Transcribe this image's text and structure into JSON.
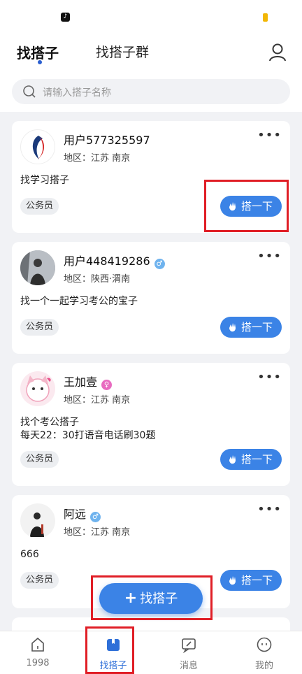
{
  "header": {
    "tabs": [
      {
        "label": "找搭子",
        "active": true
      },
      {
        "label": "找搭子群",
        "active": false
      }
    ],
    "user_icon": "user-icon"
  },
  "search": {
    "placeholder": "请输入搭子名称"
  },
  "cards": [
    {
      "name": "用户577325597",
      "gender": "",
      "region": "地区：江苏 南京",
      "desc": "找学习搭子",
      "tag": "公务员",
      "button": "搭一下"
    },
    {
      "name": "用户448419286",
      "gender": "male",
      "gender_symbol": "♂",
      "region": "地区：陕西·渭南",
      "desc": "找一个一起学习考公的宝子",
      "tag": "公务员",
      "button": "搭一下"
    },
    {
      "name": "王加壹",
      "gender": "female",
      "gender_symbol": "♀",
      "region": "地区：江苏 南京",
      "desc_lines": [
        "找个考公搭子",
        "每天22：30打语音电话刷30题"
      ],
      "tag": "公务员",
      "button": "搭一下"
    },
    {
      "name": "阿远",
      "gender": "male",
      "gender_symbol": "♂",
      "region": "地区：江苏 南京",
      "desc": "666",
      "tag": "公务员",
      "button": "搭一下"
    }
  ],
  "fab": {
    "label": "找搭子",
    "plus": "+"
  },
  "nav": [
    {
      "label": "1998",
      "icon": "home-icon",
      "active": false
    },
    {
      "label": "找搭子",
      "icon": "find-partner-icon",
      "active": true
    },
    {
      "label": "消息",
      "icon": "message-icon",
      "active": false
    },
    {
      "label": "我的",
      "icon": "profile-icon",
      "active": false
    }
  ],
  "colors": {
    "accent": "#3b83e6",
    "highlight": "#e01e26",
    "male": "#6fb3ee",
    "female": "#e86bc0"
  }
}
